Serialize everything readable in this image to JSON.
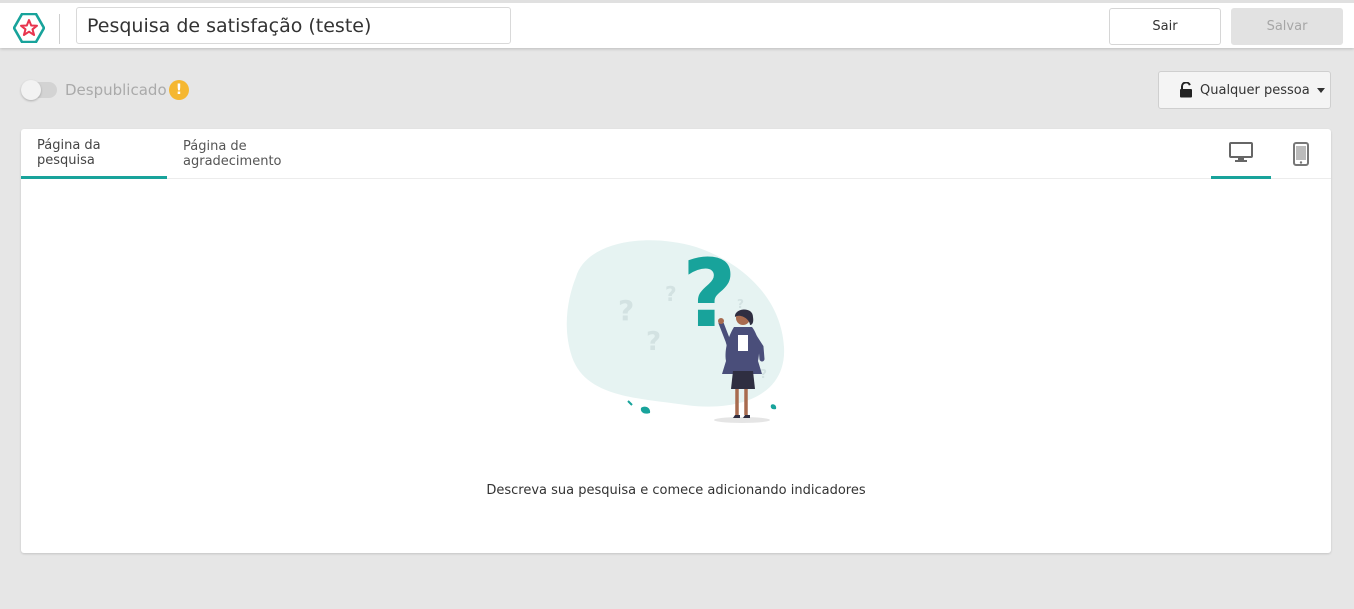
{
  "header": {
    "survey_title": "Pesquisa de satisfação (teste)",
    "exit_label": "Sair",
    "save_label": "Salvar",
    "logo_icon": "star-logo-icon"
  },
  "status": {
    "publish_label": "Despublicado",
    "published": false,
    "warning_icon": "exclamation-icon",
    "access_label": "Qualquer pessoa",
    "access_icon": "unlocked-icon"
  },
  "tabs": [
    {
      "label": "Página da pesquisa",
      "active": true
    },
    {
      "label": "Página de agradecimento",
      "active": false
    }
  ],
  "devices": [
    {
      "icon": "desktop-icon",
      "active": true
    },
    {
      "icon": "mobile-icon",
      "active": false
    }
  ],
  "empty_state": {
    "message": "Descreva sua pesquisa e comece adicionando indicadores"
  },
  "colors": {
    "accent": "#18a39b",
    "warning": "#f5b731",
    "brand_red": "#e8344e",
    "background": "#e6e6e6"
  }
}
